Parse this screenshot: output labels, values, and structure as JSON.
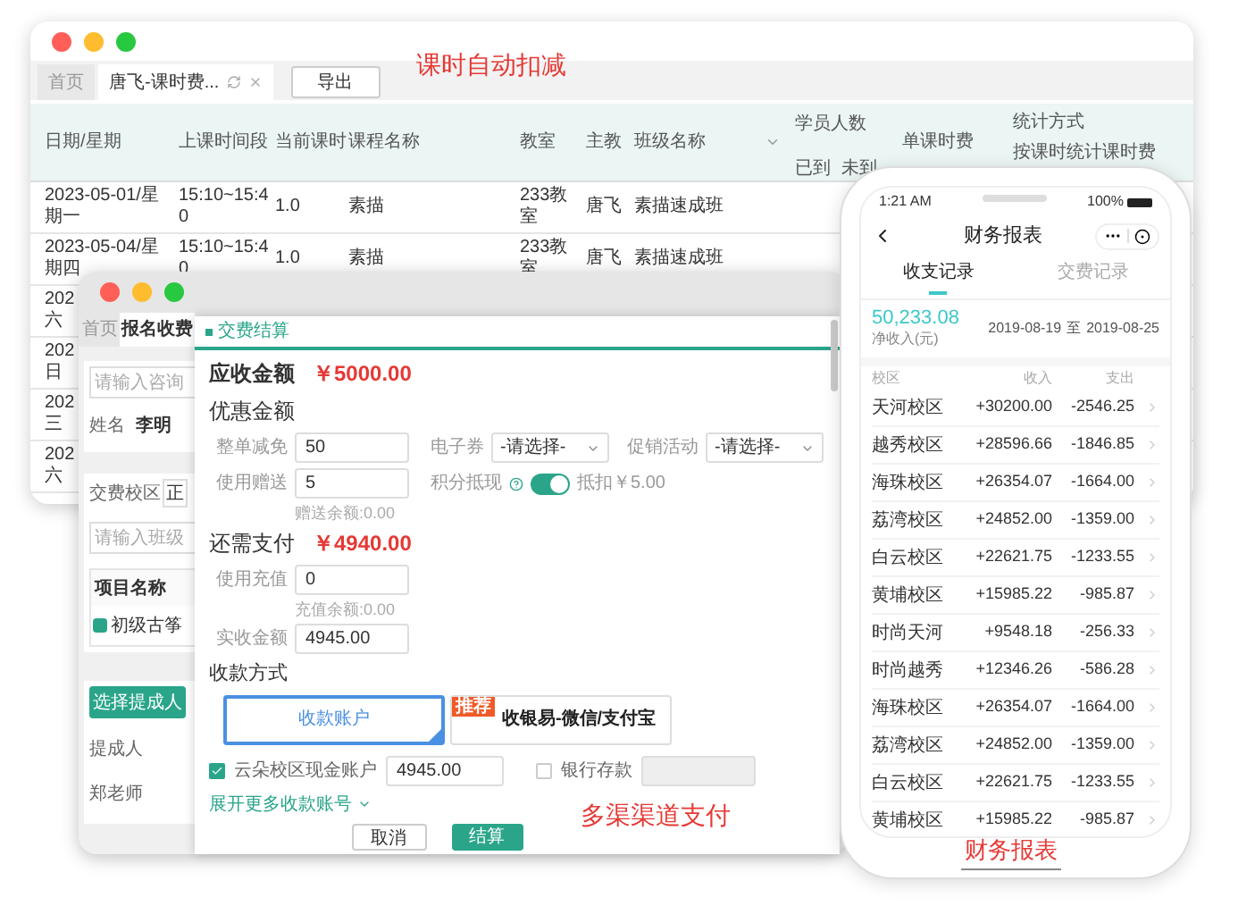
{
  "caption_top": "课时自动扣减",
  "lesson_window": {
    "tabs": [
      {
        "label": "首页",
        "selected": false
      },
      {
        "label": "唐飞-课时费...",
        "selected": true
      }
    ],
    "export_button": "导出",
    "columns": [
      "日期/星期",
      "上课时间段",
      "当前课时",
      "课程名称",
      "教室",
      "主教",
      "班级名称"
    ],
    "student_column": {
      "label": "学员人数",
      "sub": [
        "已到",
        "未到"
      ]
    },
    "fee_column": "单课时费",
    "stat_column": {
      "label": "统计方式",
      "value": "按课时统计课时费"
    },
    "rows": [
      {
        "cells": [
          "2023-05-01/星期一",
          "15:10~15:40",
          "1.0",
          "素描",
          "233教室",
          "唐飞",
          "素描速成班"
        ]
      },
      {
        "cells": [
          "2023-05-04/星期四",
          "15:10~15:40",
          "1.0",
          "素描",
          "233教室",
          "唐飞",
          "素描速成班"
        ]
      }
    ],
    "partial_rows": [
      {
        "year": "202",
        "weekday": "六"
      },
      {
        "year": "202",
        "weekday": "日"
      },
      {
        "year": "202",
        "weekday": "三"
      },
      {
        "year": "202",
        "weekday": "六"
      }
    ]
  },
  "form_window": {
    "tabs": [
      {
        "label": "首页",
        "selected": false
      },
      {
        "label": "报名收费",
        "selected": true
      }
    ],
    "search_placeholder": "请输入咨询",
    "name_label": "姓名",
    "name_value": "李明",
    "campus_label": "交费校区",
    "campus_value": "正",
    "class_placeholder": "请输入班级",
    "item_header": "项目名称",
    "item": "初级古筝",
    "pick_button": "选择提成人",
    "commission_label": "提成人",
    "commission_value": "郑老师"
  },
  "dialog": {
    "title": "交费结算",
    "due": {
      "label": "应收金额",
      "amount": "￥5000.00"
    },
    "discount_heading": "优惠金额",
    "whole_discount": {
      "label": "整单减免",
      "value": "50"
    },
    "coupon": {
      "label": "电子券",
      "placeholder": "-请选择-"
    },
    "promotion": {
      "label": "促销活动",
      "placeholder": "-请选择-"
    },
    "gift": {
      "label": "使用赠送",
      "value": "5",
      "note": "赠送余额:0.00"
    },
    "points": {
      "label": "积分抵现",
      "on": true,
      "note": "抵扣￥5.00"
    },
    "remaining": {
      "label": "还需支付",
      "amount": "￥4940.00"
    },
    "recharge": {
      "label": "使用充值",
      "value": "0",
      "note": "充值余额:0.00"
    },
    "received": {
      "label": "实收金额",
      "value": "4945.00"
    },
    "payment_heading": "收款方式",
    "methods": [
      {
        "label": "收款账户",
        "selected": true
      },
      {
        "label": "收银易-微信/支付宝",
        "selected": false,
        "badge": "推荐"
      }
    ],
    "accounts": [
      {
        "label": "云朵校区现金账户",
        "checked": true,
        "value": "4945.00"
      },
      {
        "label": "银行存款",
        "checked": false
      }
    ],
    "expand_link": "展开更多收款账号",
    "buttons": [
      {
        "label": "取消",
        "kind": "secondary"
      },
      {
        "label": "结算",
        "kind": "primary"
      }
    ]
  },
  "caption_middle": "多渠渠道支付",
  "phone": {
    "time": "1:21 AM",
    "battery": "100%",
    "title": "财务报表",
    "tabs": [
      {
        "label": "收支记录",
        "selected": true
      },
      {
        "label": "交费记录",
        "selected": false
      }
    ],
    "net_amount": "50,233.08",
    "net_label": "净收入(元)",
    "date_from": "2019-08-19",
    "date_sep": "至",
    "date_to": "2019-08-25",
    "columns": [
      "校区",
      "收入",
      "支出"
    ],
    "rows": [
      {
        "campus": "天河校区",
        "income": "+30200.00",
        "expense": "-2546.25"
      },
      {
        "campus": "越秀校区",
        "income": "+28596.66",
        "expense": "-1846.85"
      },
      {
        "campus": "海珠校区",
        "income": "+26354.07",
        "expense": "-1664.00"
      },
      {
        "campus": "荔湾校区",
        "income": "+24852.00",
        "expense": "-1359.00"
      },
      {
        "campus": "白云校区",
        "income": "+22621.75",
        "expense": "-1233.55"
      },
      {
        "campus": "黄埔校区",
        "income": "+15985.22",
        "expense": "-985.87"
      },
      {
        "campus": "时尚天河",
        "income": "+9548.18",
        "expense": "-256.33"
      },
      {
        "campus": "时尚越秀",
        "income": "+12346.26",
        "expense": "-586.28"
      },
      {
        "campus": "海珠校区",
        "income": "+26354.07",
        "expense": "-1664.00"
      },
      {
        "campus": "荔湾校区",
        "income": "+24852.00",
        "expense": "-1359.00"
      },
      {
        "campus": "白云校区",
        "income": "+22621.75",
        "expense": "-1233.55"
      },
      {
        "campus": "黄埔校区",
        "income": "+15985.22",
        "expense": "-985.87"
      }
    ]
  },
  "caption_bottom": "财务报表"
}
